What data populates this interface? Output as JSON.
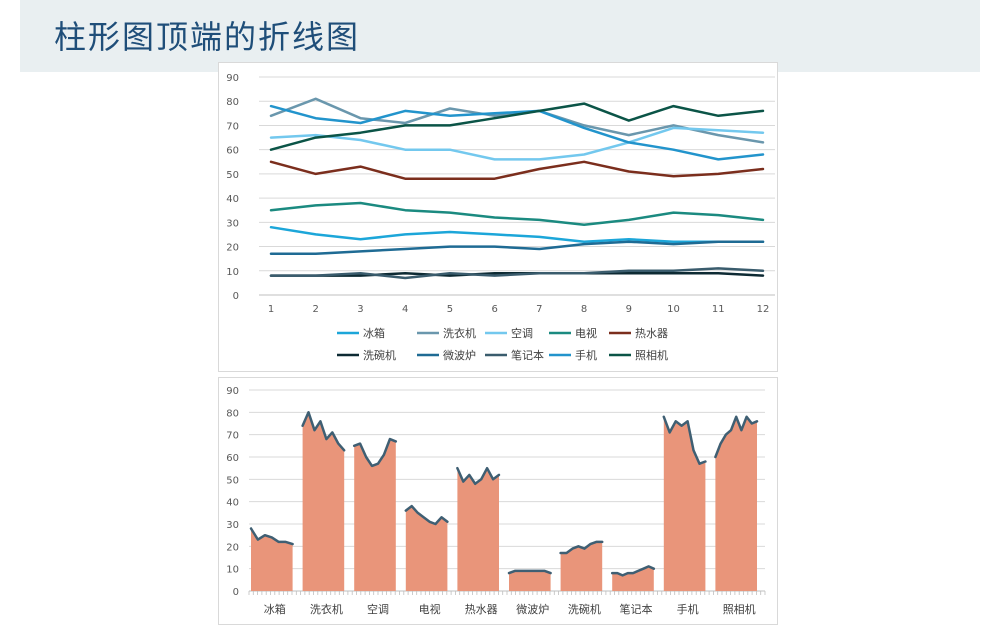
{
  "page": {
    "title": "柱形图顶端的折线图"
  },
  "chart_data": [
    {
      "type": "line",
      "x": [
        1,
        2,
        3,
        4,
        5,
        6,
        7,
        8,
        9,
        10,
        11,
        12
      ],
      "ylim": [
        0,
        90
      ],
      "yticks": [
        0,
        10,
        20,
        30,
        40,
        50,
        60,
        70,
        80,
        90
      ],
      "grid": true,
      "legend_position": "bottom",
      "series": [
        {
          "name": "冰箱",
          "color": "#1ca6d9",
          "values": [
            28,
            25,
            23,
            25,
            26,
            25,
            24,
            22,
            23,
            22,
            22,
            22
          ]
        },
        {
          "name": "洗衣机",
          "color": "#6a97ad",
          "values": [
            74,
            81,
            73,
            71,
            77,
            74,
            76,
            70,
            66,
            70,
            66,
            63
          ]
        },
        {
          "name": "空调",
          "color": "#73c8ee",
          "values": [
            65,
            66,
            64,
            60,
            60,
            56,
            56,
            58,
            63,
            69,
            68,
            67
          ]
        },
        {
          "name": "电视",
          "color": "#1b8a80",
          "values": [
            35,
            37,
            38,
            35,
            34,
            32,
            31,
            29,
            31,
            34,
            33,
            31
          ]
        },
        {
          "name": "热水器",
          "color": "#7b2e1d",
          "values": [
            55,
            50,
            53,
            48,
            48,
            48,
            52,
            55,
            51,
            49,
            50,
            52
          ]
        },
        {
          "name": "洗碗机",
          "color": "#0d2a33",
          "values": [
            8,
            8,
            8,
            9,
            8,
            9,
            9,
            9,
            9,
            9,
            9,
            8
          ]
        },
        {
          "name": "微波炉",
          "color": "#1f6b94",
          "values": [
            17,
            17,
            18,
            19,
            20,
            20,
            19,
            21,
            22,
            21,
            22,
            22
          ]
        },
        {
          "name": "笔记本",
          "color": "#3a5c6d",
          "values": [
            8,
            8,
            9,
            7,
            9,
            8,
            9,
            9,
            10,
            10,
            11,
            10
          ]
        },
        {
          "name": "手机",
          "color": "#2294cc",
          "values": [
            78,
            73,
            71,
            76,
            74,
            75,
            76,
            69,
            63,
            60,
            56,
            58
          ]
        },
        {
          "name": "照相机",
          "color": "#0b5447",
          "values": [
            60,
            65,
            67,
            70,
            70,
            73,
            76,
            79,
            72,
            78,
            74,
            76
          ]
        }
      ]
    },
    {
      "type": "area",
      "categories": [
        "冰箱",
        "洗衣机",
        "空调",
        "电视",
        "热水器",
        "微波炉",
        "洗碗机",
        "笔记本",
        "手机",
        "照相机"
      ],
      "ylim": [
        0,
        90
      ],
      "yticks": [
        0,
        10,
        20,
        30,
        40,
        50,
        60,
        70,
        80,
        90
      ],
      "fill_color": "#e9957a",
      "line_color": "#3f5f73",
      "series": [
        {
          "name": "冰箱",
          "values": [
            28,
            23,
            25,
            24,
            22,
            22,
            21
          ]
        },
        {
          "name": "洗衣机",
          "values": [
            74,
            80,
            72,
            76,
            68,
            71,
            66,
            63
          ]
        },
        {
          "name": "空调",
          "values": [
            65,
            66,
            60,
            56,
            57,
            61,
            68,
            67
          ]
        },
        {
          "name": "电视",
          "values": [
            36,
            38,
            35,
            33,
            31,
            30,
            33,
            31
          ]
        },
        {
          "name": "热水器",
          "values": [
            55,
            49,
            52,
            48,
            50,
            55,
            50,
            52
          ]
        },
        {
          "name": "微波炉",
          "values": [
            8,
            9,
            9,
            9,
            9,
            9,
            9,
            8
          ]
        },
        {
          "name": "洗碗机",
          "values": [
            17,
            17,
            19,
            20,
            19,
            21,
            22,
            22
          ]
        },
        {
          "name": "笔记本",
          "values": [
            8,
            8,
            7,
            8,
            8,
            9,
            10,
            11,
            10
          ]
        },
        {
          "name": "手机",
          "values": [
            78,
            71,
            76,
            74,
            76,
            63,
            57,
            58
          ]
        },
        {
          "name": "照相机",
          "values": [
            60,
            66,
            70,
            72,
            78,
            72,
            78,
            75,
            76
          ]
        }
      ]
    }
  ]
}
